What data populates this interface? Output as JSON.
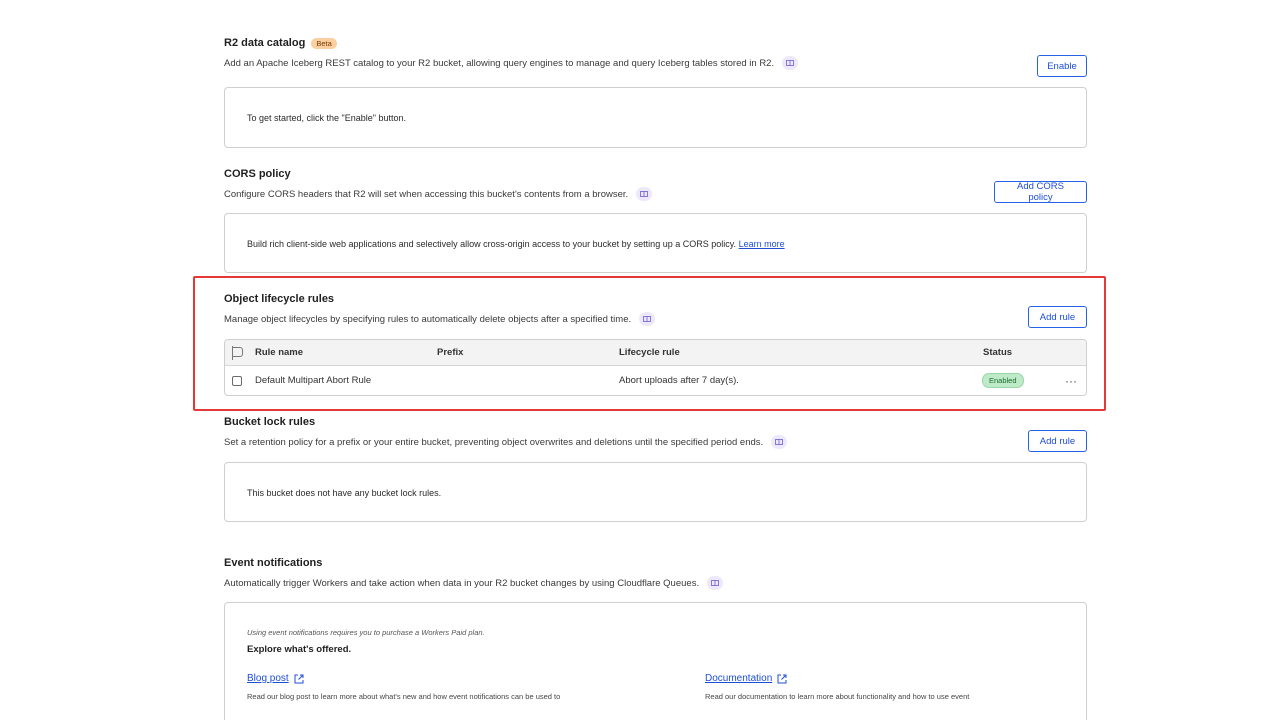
{
  "r2_catalog": {
    "title": "R2 data catalog",
    "badge": "Beta",
    "description": "Add an Apache Iceberg REST catalog to your R2 bucket, allowing query engines to manage and query Iceberg tables stored in R2.",
    "button": "Enable",
    "panel_text": "To get started, click the \"Enable\" button."
  },
  "cors": {
    "title": "CORS policy",
    "description": "Configure CORS headers that R2 will set when accessing this bucket's contents from a browser.",
    "button": "Add CORS policy",
    "panel_text": "Build rich client-side web applications and selectively allow cross-origin access to your bucket by setting up a CORS policy.",
    "learn_more": "Learn more"
  },
  "lifecycle": {
    "title": "Object lifecycle rules",
    "description": "Manage object lifecycles by specifying rules to automatically delete objects after a specified time.",
    "button": "Add rule",
    "columns": {
      "rule_name": "Rule name",
      "prefix": "Prefix",
      "lifecycle_rule": "Lifecycle rule",
      "status": "Status"
    },
    "rows": [
      {
        "rule_name": "Default Multipart Abort Rule",
        "prefix": "",
        "lifecycle_rule": "Abort uploads after 7 day(s).",
        "status": "Enabled",
        "menu": "···"
      }
    ]
  },
  "bucket_lock": {
    "title": "Bucket lock rules",
    "description": "Set a retention policy for a prefix or your entire bucket, preventing object overwrites and deletions until the specified period ends.",
    "button": "Add rule",
    "panel_text": "This bucket does not have any bucket lock rules."
  },
  "events": {
    "title": "Event notifications",
    "description": "Automatically trigger Workers and take action when data in your R2 bucket changes by using Cloudflare Queues.",
    "note": "Using event notifications requires you to purchase a Workers Paid plan.",
    "explore": "Explore what's offered.",
    "blog_link": "Blog post",
    "blog_desc": "Read our blog post to learn more about what's new and how event notifications can be used to",
    "docs_link": "Documentation",
    "docs_desc": "Read our documentation to learn more about functionality and how to use event"
  },
  "colors": {
    "accent": "#2563eb",
    "highlight": "#e53935",
    "beta_bg": "#fbcf9f",
    "enabled_bg": "#bfeac7"
  },
  "icons": [
    "docs-icon",
    "external-link-icon",
    "flag-icon",
    "checkbox-icon",
    "more-icon"
  ]
}
